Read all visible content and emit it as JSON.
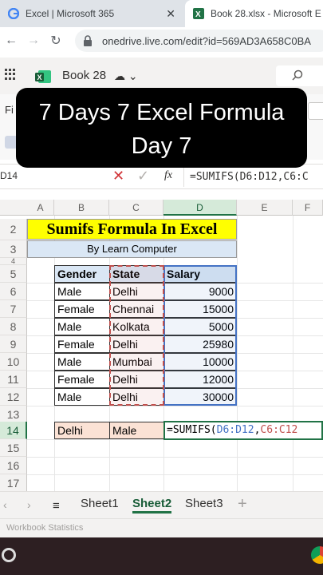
{
  "browser": {
    "tabs": [
      {
        "label": "Excel | Microsoft 365",
        "icon": "google-g-icon"
      },
      {
        "label": "Book 28.xlsx - Microsoft E",
        "icon": "excel-icon"
      }
    ],
    "url": "onedrive.live.com/edit?id=569AD3A658C0BA"
  },
  "app": {
    "book_title": "Book 28",
    "ribbon_left": "Fi"
  },
  "formula_bar": {
    "name_box": "D14",
    "formula": "=SUMIFS(D6:D12,C6:C"
  },
  "grid": {
    "columns": [
      "A",
      "B",
      "C",
      "D",
      "E",
      "F"
    ],
    "rows": [
      "2",
      "3",
      "4",
      "5",
      "6",
      "7",
      "8",
      "9",
      "10",
      "11",
      "12",
      "13",
      "14",
      "15",
      "16",
      "17"
    ],
    "active_column": "D",
    "active_row": "14"
  },
  "sheet": {
    "title": "Sumifs Formula In Excel",
    "subtitle": "By Learn Computer",
    "table": {
      "headers": [
        "Gender",
        "State",
        "Salary"
      ],
      "rows": [
        [
          "Male",
          "Delhi",
          "9000"
        ],
        [
          "Female",
          "Chennai",
          "15000"
        ],
        [
          "Male",
          "Kolkata",
          "5000"
        ],
        [
          "Female",
          "Delhi",
          "25980"
        ],
        [
          "Male",
          "Mumbai",
          "10000"
        ],
        [
          "Female",
          "Delhi",
          "12000"
        ],
        [
          "Male",
          "Delhi",
          "30000"
        ]
      ]
    },
    "criteria": [
      "Delhi",
      "Male"
    ],
    "active_formula_prefix": "=SUMIFS(",
    "active_formula_ref1": "D6:D12",
    "active_formula_comma": ",",
    "active_formula_ref2": "C6:C12",
    "ref1_color": "#4472c4",
    "ref2_color": "#c0504d"
  },
  "sheet_tabs": {
    "tabs": [
      "Sheet1",
      "Sheet2",
      "Sheet3"
    ],
    "active": "Sheet2"
  },
  "status": {
    "workbook_statistics": "Workbook Statistics"
  },
  "overlay": {
    "line1": "7 Days 7 Excel Formula",
    "line2": "Day 7"
  },
  "colors": {
    "excel_green": "#217346",
    "title_fill": "#ffff00",
    "header_fill": "#dae7f5",
    "criteria_fill": "#fbe2d5"
  }
}
